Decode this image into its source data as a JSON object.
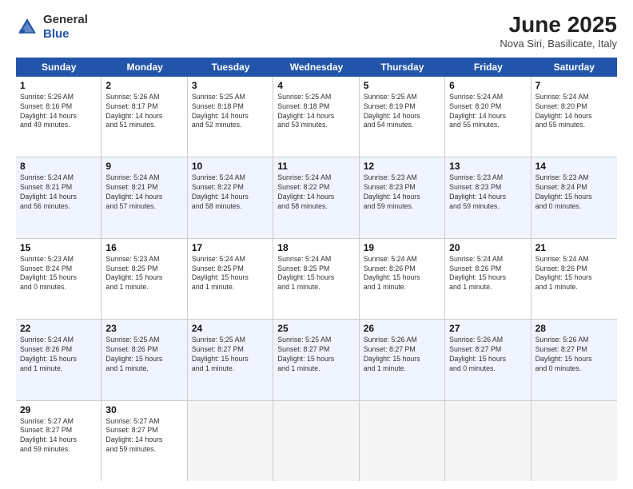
{
  "header": {
    "logo_general": "General",
    "logo_blue": "Blue",
    "month_title": "June 2025",
    "location": "Nova Siri, Basilicate, Italy"
  },
  "days": [
    "Sunday",
    "Monday",
    "Tuesday",
    "Wednesday",
    "Thursday",
    "Friday",
    "Saturday"
  ],
  "rows": [
    [
      {
        "num": "1",
        "info": "Sunrise: 5:26 AM\nSunset: 8:16 PM\nDaylight: 14 hours\nand 49 minutes."
      },
      {
        "num": "2",
        "info": "Sunrise: 5:26 AM\nSunset: 8:17 PM\nDaylight: 14 hours\nand 51 minutes."
      },
      {
        "num": "3",
        "info": "Sunrise: 5:25 AM\nSunset: 8:18 PM\nDaylight: 14 hours\nand 52 minutes."
      },
      {
        "num": "4",
        "info": "Sunrise: 5:25 AM\nSunset: 8:18 PM\nDaylight: 14 hours\nand 53 minutes."
      },
      {
        "num": "5",
        "info": "Sunrise: 5:25 AM\nSunset: 8:19 PM\nDaylight: 14 hours\nand 54 minutes."
      },
      {
        "num": "6",
        "info": "Sunrise: 5:24 AM\nSunset: 8:20 PM\nDaylight: 14 hours\nand 55 minutes."
      },
      {
        "num": "7",
        "info": "Sunrise: 5:24 AM\nSunset: 8:20 PM\nDaylight: 14 hours\nand 55 minutes."
      }
    ],
    [
      {
        "num": "8",
        "info": "Sunrise: 5:24 AM\nSunset: 8:21 PM\nDaylight: 14 hours\nand 56 minutes."
      },
      {
        "num": "9",
        "info": "Sunrise: 5:24 AM\nSunset: 8:21 PM\nDaylight: 14 hours\nand 57 minutes."
      },
      {
        "num": "10",
        "info": "Sunrise: 5:24 AM\nSunset: 8:22 PM\nDaylight: 14 hours\nand 58 minutes."
      },
      {
        "num": "11",
        "info": "Sunrise: 5:24 AM\nSunset: 8:22 PM\nDaylight: 14 hours\nand 58 minutes."
      },
      {
        "num": "12",
        "info": "Sunrise: 5:23 AM\nSunset: 8:23 PM\nDaylight: 14 hours\nand 59 minutes."
      },
      {
        "num": "13",
        "info": "Sunrise: 5:23 AM\nSunset: 8:23 PM\nDaylight: 14 hours\nand 59 minutes."
      },
      {
        "num": "14",
        "info": "Sunrise: 5:23 AM\nSunset: 8:24 PM\nDaylight: 15 hours\nand 0 minutes."
      }
    ],
    [
      {
        "num": "15",
        "info": "Sunrise: 5:23 AM\nSunset: 8:24 PM\nDaylight: 15 hours\nand 0 minutes."
      },
      {
        "num": "16",
        "info": "Sunrise: 5:23 AM\nSunset: 8:25 PM\nDaylight: 15 hours\nand 1 minute."
      },
      {
        "num": "17",
        "info": "Sunrise: 5:24 AM\nSunset: 8:25 PM\nDaylight: 15 hours\nand 1 minute."
      },
      {
        "num": "18",
        "info": "Sunrise: 5:24 AM\nSunset: 8:25 PM\nDaylight: 15 hours\nand 1 minute."
      },
      {
        "num": "19",
        "info": "Sunrise: 5:24 AM\nSunset: 8:26 PM\nDaylight: 15 hours\nand 1 minute."
      },
      {
        "num": "20",
        "info": "Sunrise: 5:24 AM\nSunset: 8:26 PM\nDaylight: 15 hours\nand 1 minute."
      },
      {
        "num": "21",
        "info": "Sunrise: 5:24 AM\nSunset: 8:26 PM\nDaylight: 15 hours\nand 1 minute."
      }
    ],
    [
      {
        "num": "22",
        "info": "Sunrise: 5:24 AM\nSunset: 8:26 PM\nDaylight: 15 hours\nand 1 minute."
      },
      {
        "num": "23",
        "info": "Sunrise: 5:25 AM\nSunset: 8:26 PM\nDaylight: 15 hours\nand 1 minute."
      },
      {
        "num": "24",
        "info": "Sunrise: 5:25 AM\nSunset: 8:27 PM\nDaylight: 15 hours\nand 1 minute."
      },
      {
        "num": "25",
        "info": "Sunrise: 5:25 AM\nSunset: 8:27 PM\nDaylight: 15 hours\nand 1 minute."
      },
      {
        "num": "26",
        "info": "Sunrise: 5:26 AM\nSunset: 8:27 PM\nDaylight: 15 hours\nand 1 minute."
      },
      {
        "num": "27",
        "info": "Sunrise: 5:26 AM\nSunset: 8:27 PM\nDaylight: 15 hours\nand 0 minutes."
      },
      {
        "num": "28",
        "info": "Sunrise: 5:26 AM\nSunset: 8:27 PM\nDaylight: 15 hours\nand 0 minutes."
      }
    ],
    [
      {
        "num": "29",
        "info": "Sunrise: 5:27 AM\nSunset: 8:27 PM\nDaylight: 14 hours\nand 59 minutes."
      },
      {
        "num": "30",
        "info": "Sunrise: 5:27 AM\nSunset: 8:27 PM\nDaylight: 14 hours\nand 59 minutes."
      },
      null,
      null,
      null,
      null,
      null
    ]
  ]
}
